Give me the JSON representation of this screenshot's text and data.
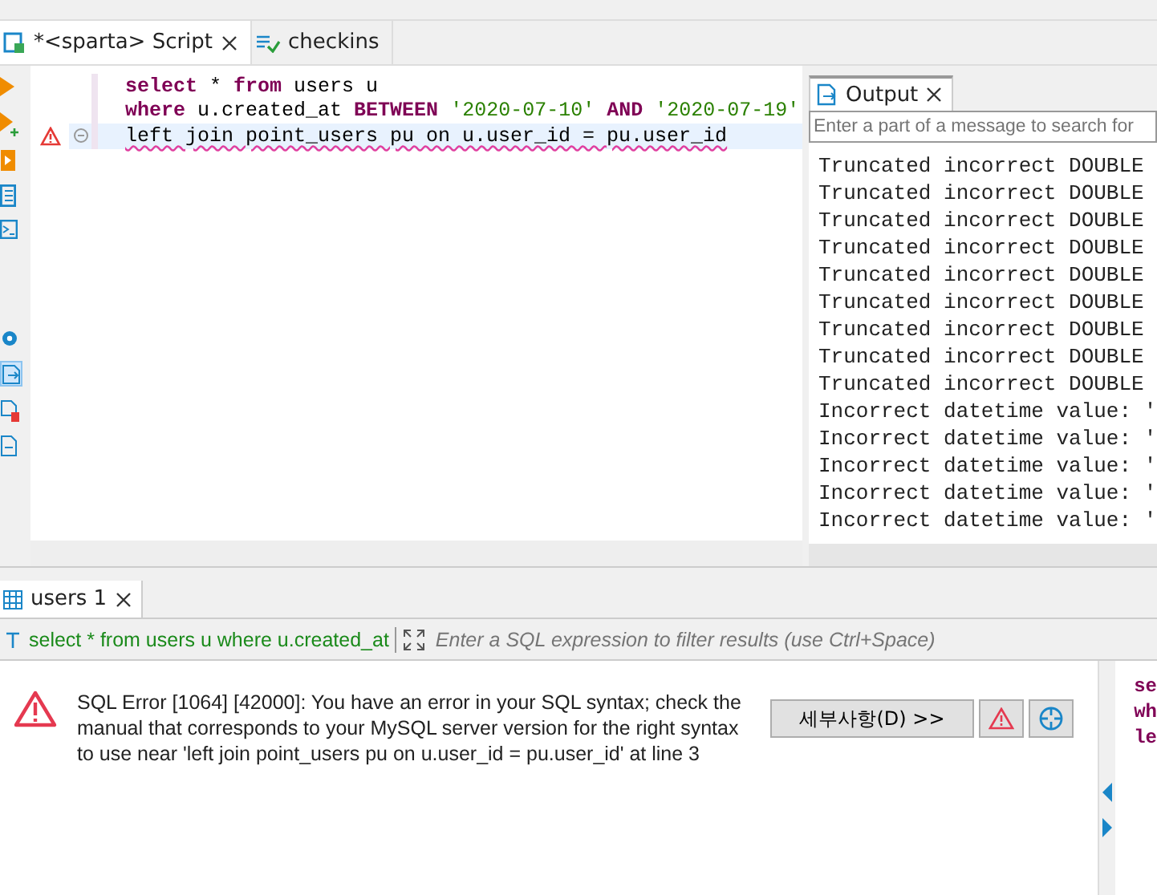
{
  "editor_tabs": [
    {
      "label": "*<sparta> Script",
      "selected": true,
      "closable": true
    },
    {
      "label": "checkins",
      "selected": false,
      "closable": false
    }
  ],
  "editor": {
    "lines": [
      {
        "error": false,
        "current": false,
        "tokens": [
          {
            "kind": "keyword",
            "text": "select"
          },
          {
            "kind": "plain",
            "text": " * "
          },
          {
            "kind": "keyword",
            "text": "from"
          },
          {
            "kind": "plain",
            "text": " users u"
          }
        ]
      },
      {
        "error": false,
        "current": false,
        "tokens": [
          {
            "kind": "keyword",
            "text": "where"
          },
          {
            "kind": "plain",
            "text": " u.created_at "
          },
          {
            "kind": "keyword",
            "text": "BETWEEN "
          },
          {
            "kind": "string",
            "text": "'2020-07-10' "
          },
          {
            "kind": "keyword",
            "text": "AND "
          },
          {
            "kind": "string",
            "text": "'2020-07-19'"
          }
        ]
      },
      {
        "error": true,
        "current": true,
        "tokens": [
          {
            "kind": "plain",
            "text": "left join point_users pu on u.user_id = pu.user_id"
          }
        ]
      }
    ]
  },
  "output": {
    "tab": "Output",
    "search_placeholder": "Enter a part of a message to search for",
    "lines": [
      "Truncated incorrect DOUBLE",
      "Truncated incorrect DOUBLE",
      "Truncated incorrect DOUBLE",
      "Truncated incorrect DOUBLE",
      "Truncated incorrect DOUBLE",
      "Truncated incorrect DOUBLE",
      "Truncated incorrect DOUBLE",
      "Truncated incorrect DOUBLE",
      "Truncated incorrect DOUBLE",
      "Incorrect datetime value: '",
      "Incorrect datetime value: '",
      "Incorrect datetime value: '",
      "Incorrect datetime value: '",
      "Incorrect datetime value: '"
    ]
  },
  "results": {
    "tab": "users 1",
    "query": "select * from users u where u.created_at",
    "filter_placeholder": "Enter a SQL expression to filter results (use Ctrl+Space)",
    "error_message": "SQL Error [1064] [42000]: You have an error in your SQL syntax; check the manual that corresponds to your MySQL server version for the right syntax to use near 'left join point_users pu on u.user_id = pu.user_id' at line 3",
    "details_button": "세부사항(D) >>",
    "side_preview": [
      "se",
      "wh",
      "le"
    ]
  }
}
